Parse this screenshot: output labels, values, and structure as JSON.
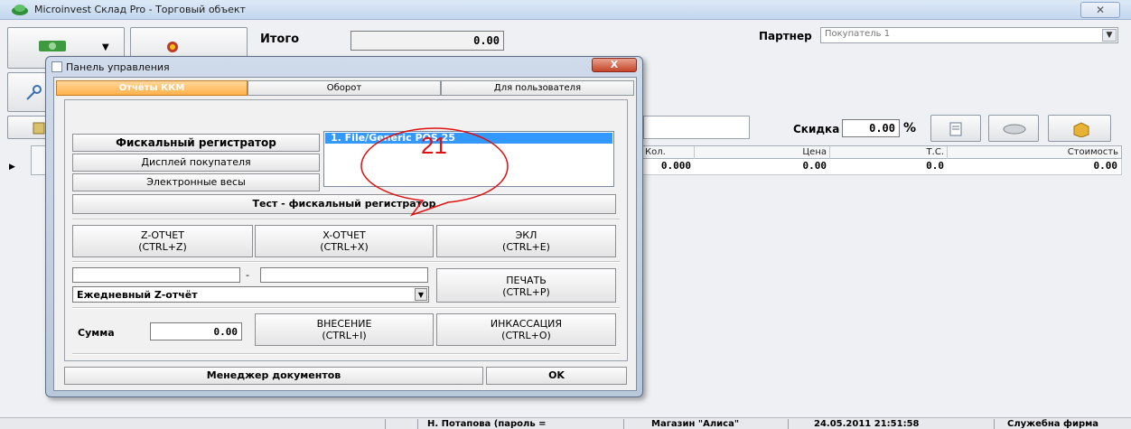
{
  "window": {
    "title": "Microinvest Склад Pro - Торговый объект",
    "close": "✕"
  },
  "summary": {
    "itogo_label": "Итого",
    "itogo_value": "0.00"
  },
  "partner": {
    "label": "Партнер",
    "value": "Покупатель 1"
  },
  "discount": {
    "label": "Скидка",
    "value": "0.00",
    "unit": "%"
  },
  "grid": {
    "columns": [
      "Кол.",
      "Цена",
      "Т.С.",
      "Стоимость"
    ],
    "row": {
      "qty": "0.000",
      "price": "0.00",
      "ts": "0.0",
      "cost": "0.00"
    }
  },
  "status": {
    "user": "Н. Потапова  (пароль =",
    "store": "Магазин \"Алиса\"",
    "datetime": "24.05.2011 21:51:58",
    "firm": "Служебна фирма"
  },
  "dialog": {
    "title": "Панель управления",
    "close": "X",
    "tabs": [
      "Отчёты ККМ",
      "Оборот",
      "Для пользователя"
    ],
    "devices": [
      "Фискальный регистратор",
      "Дисплей покупателя",
      "Электронные весы"
    ],
    "device_list": [
      "1.  File/Generic POS 25"
    ],
    "test_button": "Тест - фискальный регистратор",
    "z_report": {
      "line1": "Z-ОТЧЕТ",
      "line2": "(CTRL+Z)"
    },
    "x_report": {
      "line1": "X-ОТЧЕТ",
      "line2": "(CTRL+X)"
    },
    "ekl": {
      "line1": "ЭКЛ",
      "line2": "(CTRL+E)"
    },
    "range_sep": "-",
    "period_select": "Ежедневный Z-отчёт",
    "print": {
      "line1": "ПЕЧАТЬ",
      "line2": "(CTRL+P)"
    },
    "sum_label": "Сумма",
    "sum_value": "0.00",
    "deposit": {
      "line1": "ВНЕСЕНИЕ",
      "line2": "(CTRL+I)"
    },
    "collection": {
      "line1": "ИНКАССАЦИЯ",
      "line2": "(CTRL+O)"
    },
    "doc_manager": "Менеджер документов",
    "ok": "OK"
  },
  "annotation": {
    "number": "21",
    "color": "#e01010"
  }
}
